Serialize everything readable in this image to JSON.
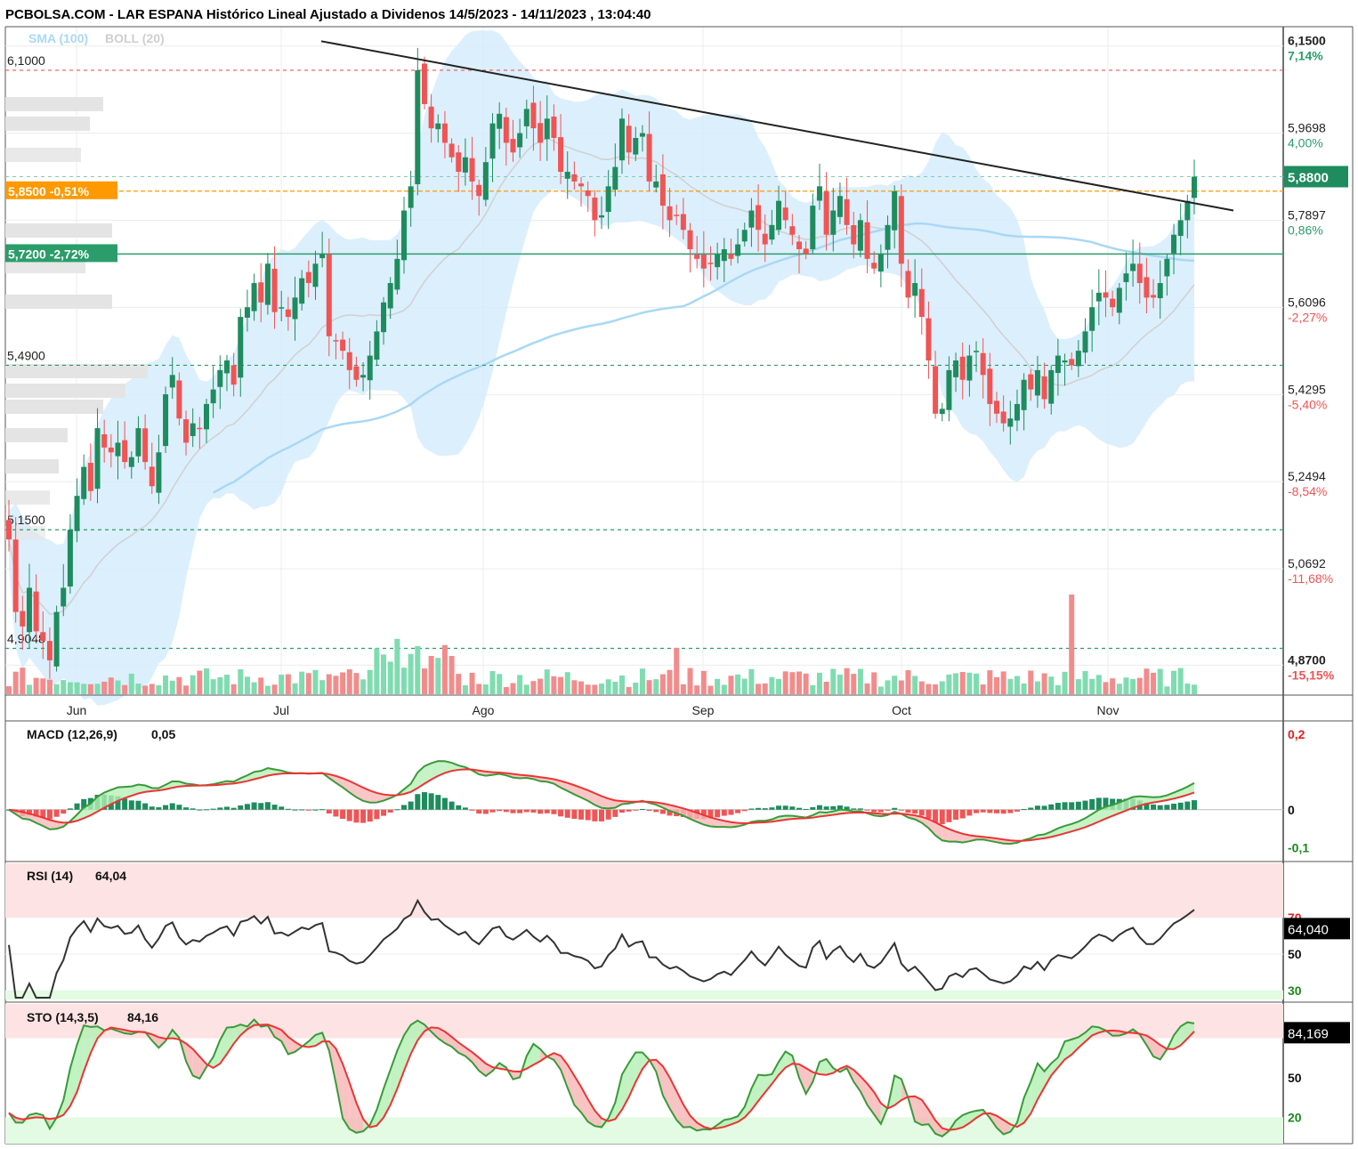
{
  "title": "PCBOLSA.COM - LAR ESPANA Histórico Lineal Ajustado a Dividenos 14/5/2023 - 14/11/2023 , 13:04:40",
  "legend": {
    "sma_label": "SMA (100)",
    "boll_label": "BOLL (20)"
  },
  "colors": {
    "up": "#1e8c5e",
    "down": "#f05454",
    "band": "#d6ecfb",
    "sma": "#a9d8f5",
    "orange": "#ff9900",
    "green_line": "#2a9d6a"
  },
  "chart_data": [
    {
      "type": "candlestick",
      "title": "LAR ESPANA",
      "x_months": [
        "Jun",
        "Jul",
        "Ago",
        "Sep",
        "Oct",
        "Nov"
      ],
      "ylim": [
        4.81,
        6.19
      ],
      "y_ticks": [
        {
          "value": 6.15,
          "label": "6,1500",
          "pct": "7,14%",
          "pct_color": "#2a9d6a",
          "bold": true
        },
        {
          "value": 5.9698,
          "label": "5,9698",
          "pct": "4,00%",
          "pct_color": "#2a9d6a",
          "bold": false
        },
        {
          "value": 5.7897,
          "label": "5,7897",
          "pct": "0,86%",
          "pct_color": "#2a9d6a",
          "bold": false
        },
        {
          "value": 5.6096,
          "label": "5,6096",
          "pct": "-2,27%",
          "pct_color": "#f05454",
          "bold": false
        },
        {
          "value": 5.4295,
          "label": "5,4295",
          "pct": "-5,40%",
          "pct_color": "#f05454",
          "bold": false
        },
        {
          "value": 5.2494,
          "label": "5,2494",
          "pct": "-8,54%",
          "pct_color": "#f05454",
          "bold": false
        },
        {
          "value": 5.0692,
          "label": "5,0692",
          "pct": "-11,68%",
          "pct_color": "#f05454",
          "bold": false
        },
        {
          "value": 4.87,
          "label": "4,8700",
          "pct": "-15,15%",
          "pct_color": "#f05454",
          "bold": true
        }
      ],
      "last_price": {
        "value": 5.88,
        "label": "5,8800"
      },
      "levels": [
        {
          "value": 6.1,
          "label": "6,1000",
          "style": "red-dashed"
        },
        {
          "value": 5.49,
          "label": "5,4900",
          "style": "green-dashed"
        },
        {
          "value": 5.15,
          "label": "5,1500",
          "style": "green-dashed"
        },
        {
          "value": 4.9048,
          "label": "4,9048",
          "style": "green-dashed"
        }
      ],
      "tags": [
        {
          "value": 5.85,
          "label": "5,8500 -0,51%",
          "style": "orange"
        },
        {
          "value": 5.72,
          "label": "5,7200 -2,72%",
          "style": "green"
        }
      ],
      "trendline": {
        "start": [
          "2023-07-08",
          6.16
        ],
        "end": [
          "2023-11-16",
          5.81
        ]
      },
      "closes": [
        5.13,
        4.98,
        4.95,
        5.03,
        4.94,
        4.92,
        4.88,
        4.98,
        5.03,
        5.15,
        5.22,
        5.28,
        5.23,
        5.36,
        5.32,
        5.31,
        5.33,
        5.29,
        5.3,
        5.36,
        5.29,
        5.24,
        5.31,
        5.43,
        5.47,
        5.38,
        5.33,
        5.37,
        5.36,
        5.41,
        5.44,
        5.48,
        5.5,
        5.45,
        5.59,
        5.61,
        5.66,
        5.62,
        5.7,
        5.6,
        5.61,
        5.59,
        5.63,
        5.67,
        5.66,
        5.7,
        5.72,
        5.55,
        5.54,
        5.52,
        5.48,
        5.46,
        5.47,
        5.51,
        5.56,
        5.62,
        5.66,
        5.71,
        5.81,
        5.86,
        6.1,
        6.03,
        5.98,
        5.99,
        5.95,
        5.92,
        5.89,
        5.92,
        5.87,
        5.84,
        5.91,
        5.99,
        6.01,
        5.95,
        5.93,
        5.97,
        6.02,
        5.98,
        5.95,
        6.0,
        5.96,
        5.89,
        5.89,
        5.87,
        5.86,
        5.84,
        5.79,
        5.8,
        5.86,
        5.9,
        6.0,
        5.93,
        5.96,
        5.97,
        5.87,
        5.87,
        5.82,
        5.79,
        5.8,
        5.77,
        5.73,
        5.71,
        5.69,
        5.7,
        5.72,
        5.73,
        5.71,
        5.74,
        5.77,
        5.81,
        5.77,
        5.74,
        5.78,
        5.83,
        5.79,
        5.76,
        5.73,
        5.72,
        5.82,
        5.86,
        5.76,
        5.81,
        5.84,
        5.78,
        5.74,
        5.79,
        5.71,
        5.69,
        5.72,
        5.78,
        5.85,
        5.7,
        5.63,
        5.66,
        5.59,
        5.5,
        5.39,
        5.4,
        5.48,
        5.5,
        5.46,
        5.51,
        5.52,
        5.47,
        5.41,
        5.39,
        5.37,
        5.38,
        5.41,
        5.46,
        5.44,
        5.48,
        5.42,
        5.48,
        5.51,
        5.5,
        5.49,
        5.52,
        5.56,
        5.61,
        5.64,
        5.63,
        5.61,
        5.65,
        5.68,
        5.7,
        5.66,
        5.63,
        5.63,
        5.66,
        5.71,
        5.76,
        5.79,
        5.83,
        5.88
      ]
    },
    {
      "type": "line",
      "title": "MACD (12,26,9)",
      "value_label": "0,05",
      "ylim": [
        -0.13,
        0.23
      ],
      "y_ticks": [
        {
          "value": 0.2,
          "label": "0,2",
          "color": "#e02020"
        },
        {
          "value": 0,
          "label": "0",
          "color": "#111111"
        },
        {
          "value": -0.1,
          "label": "-0,1",
          "color": "#1a8a1a"
        }
      ]
    },
    {
      "type": "line",
      "title": "RSI (14)",
      "value_label": "64,04",
      "last_value_label": "64,040",
      "ylim": [
        25,
        100
      ],
      "y_ticks": [
        {
          "value": 70,
          "label": "70",
          "color": "#e02020"
        },
        {
          "value": 50,
          "label": "50",
          "color": "#111111"
        },
        {
          "value": 30,
          "label": "30",
          "color": "#1a8a1a"
        }
      ]
    },
    {
      "type": "line",
      "title": "STO (14,3,5)",
      "value_label": "84,16",
      "last_value_label": "84,169",
      "ylim": [
        0,
        106
      ],
      "y_ticks": [
        {
          "value": 50,
          "label": "50",
          "color": "#111111"
        },
        {
          "value": 20,
          "label": "20",
          "color": "#1a8a1a"
        }
      ]
    }
  ]
}
